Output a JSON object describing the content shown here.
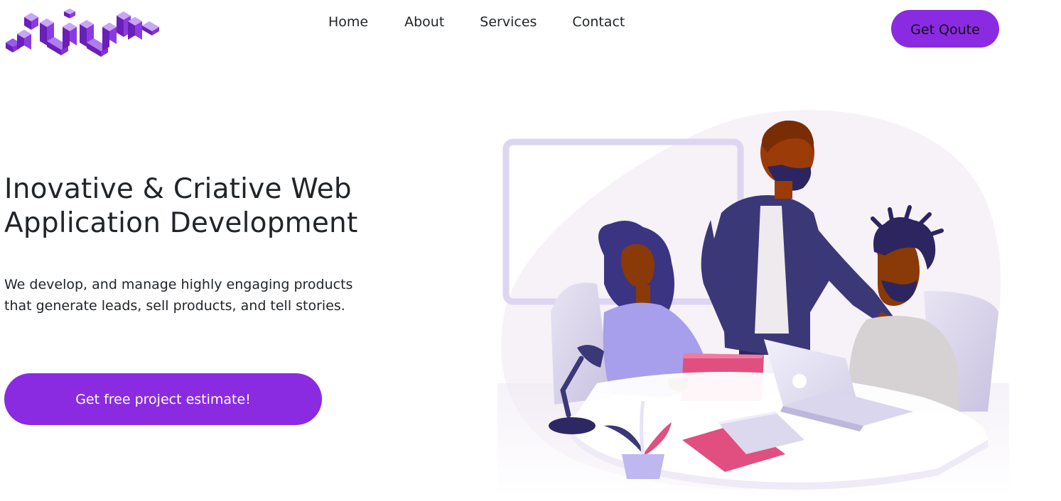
{
  "header": {
    "nav": [
      {
        "label": "Home"
      },
      {
        "label": "About"
      },
      {
        "label": "Services"
      },
      {
        "label": "Contact"
      }
    ],
    "quote_button": "Get Qoute"
  },
  "hero": {
    "title_line1": "Inovative & Criative Web",
    "title_line2": "Application Development",
    "description": "We develop, and manage highly engaging products that generate leads, sell products, and tell stories.",
    "cta": "Get free project estimate!"
  },
  "colors": {
    "accent": "#8a2be2",
    "text": "#212529",
    "logo_light": "#b07cf0",
    "logo_dark": "#6a1fb8"
  },
  "icons": {
    "logo": "brand-logo",
    "illustration": "team-meeting-illustration"
  }
}
